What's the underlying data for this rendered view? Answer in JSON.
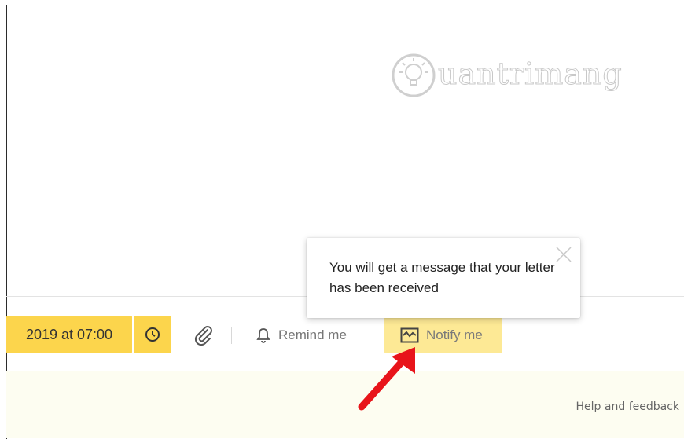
{
  "watermark": {
    "text": "uantrimang"
  },
  "toolbar": {
    "date_label": "2019 at 07:00",
    "clock_icon": "clock-icon",
    "attach_icon": "paperclip-icon",
    "remind_label": "Remind me",
    "remind_icon": "bell-icon",
    "notify_label": "Notify me",
    "notify_icon": "envelope-check-icon"
  },
  "tooltip": {
    "message": "You will get a message that your letter has been received",
    "close_icon": "close-icon"
  },
  "footer": {
    "help_label": "Help and feedback"
  },
  "colors": {
    "accent": "#fcd54c",
    "accent_light": "#fde995",
    "arrow": "#e8141a",
    "footer_bg": "#fdfdf1"
  }
}
